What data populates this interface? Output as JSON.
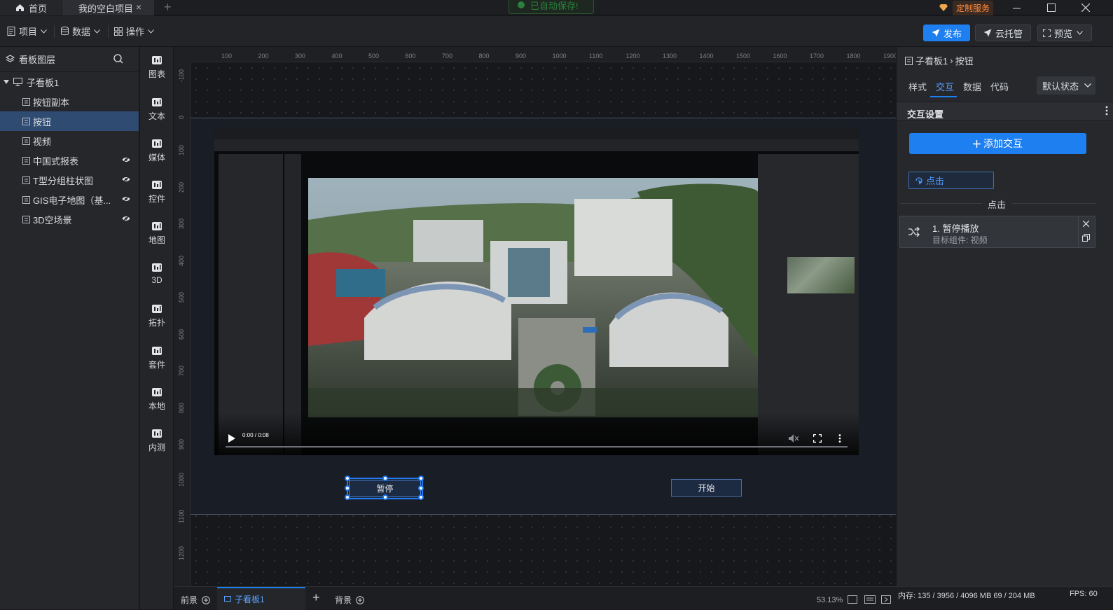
{
  "titlebar": {
    "home_tab": "首页",
    "project_tab": "我的空白项目",
    "autosave": "已自动保存!",
    "custom_service": "定制服务"
  },
  "toolbar": {
    "menu_project": "项目",
    "menu_data": "数据",
    "menu_ops": "操作",
    "publish": "发布",
    "cloud": "云托管",
    "preview": "预览"
  },
  "layers": {
    "title": "看板图层",
    "root": "子看板1",
    "items": [
      {
        "label": "按钮副本",
        "icon": "button-icon"
      },
      {
        "label": "按钮",
        "icon": "button-icon"
      },
      {
        "label": "视频",
        "icon": "video-icon"
      },
      {
        "label": "中国式报表",
        "icon": "report-icon"
      },
      {
        "label": "T型分组柱状图",
        "icon": "bar-chart-icon"
      },
      {
        "label": "GIS电子地图（基...",
        "icon": "map-icon"
      },
      {
        "label": "3D空场景",
        "icon": "cube-icon"
      }
    ]
  },
  "components": [
    "图表",
    "文本",
    "媒体",
    "控件",
    "地图",
    "3D",
    "拓扑",
    "套件",
    "本地",
    "内测"
  ],
  "ruler": {
    "top": [
      "100",
      "200",
      "300",
      "400",
      "500",
      "600",
      "700",
      "800",
      "900",
      "1000",
      "1100",
      "1200",
      "1300",
      "1400",
      "1500",
      "1600",
      "1700",
      "1800",
      "1900"
    ],
    "left": [
      "-100",
      "0",
      "100",
      "200",
      "300",
      "400",
      "500",
      "600",
      "700",
      "800",
      "900",
      "1000",
      "1100",
      "1200"
    ]
  },
  "canvas": {
    "video_time": "0:00 / 0:08",
    "pause_button": "暂停",
    "start_button": "开始"
  },
  "bottom": {
    "tab_front": "前景",
    "tab_board": "子看板1",
    "tab_back": "背景",
    "zoom": "53.13%"
  },
  "right_panel": {
    "breadcrumb_parent": "子看板1",
    "breadcrumb_sep": "›",
    "breadcrumb_current": "按钮",
    "tabs": [
      "样式",
      "交互",
      "数据",
      "代码"
    ],
    "state_select": "默认状态",
    "section_title": "交互设置",
    "add_interaction": "添加交互",
    "trigger": "点击",
    "divider_label": "点击",
    "action_title": "1. 暂停播放",
    "action_target": "目标组件: 视频"
  },
  "status": {
    "memory": "内存: 135 / 3956 / 4096 MB  69 / 204 MB",
    "fps": "FPS: 60"
  },
  "colors": {
    "accent": "#1e7ff0",
    "selected_layer": "#2f4b72",
    "autosave_green": "#2ea143",
    "service_orange": "#ff8a3d"
  }
}
